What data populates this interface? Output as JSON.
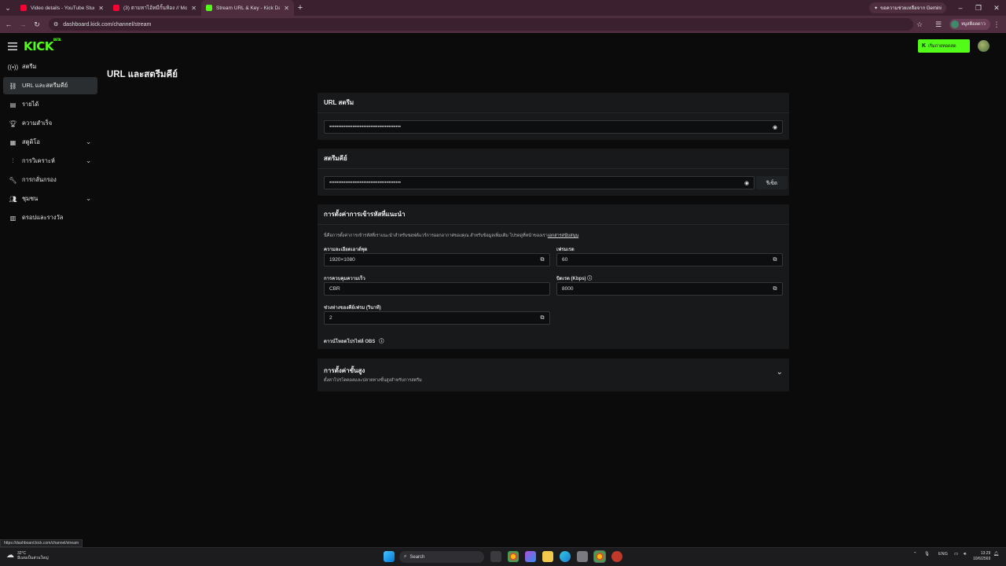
{
  "browser": {
    "tabs": [
      {
        "title": "Video details - YouTube Studio",
        "favicon_color": "#ff0033"
      },
      {
        "title": "(3) ตามหาไอ้หมีกั้นห้อง // Monster...",
        "favicon_color": "#ff0033"
      },
      {
        "title": "Stream URL & Key - Kick Dashb...",
        "favicon_color": "#53fc18"
      }
    ],
    "gemini_label": "ขอความช่วยเหลือจาก Gemini",
    "url": "dashboard.kick.com/channel/stream",
    "profile_name": "หมูสต็อดดาว"
  },
  "header": {
    "logo": "KICK",
    "logo_sup": "BETA",
    "go_live_label": "เริ่มถ่ายทอดสด"
  },
  "sidebar": {
    "items": [
      {
        "label": "สตรีม",
        "icon": "stream-icon"
      },
      {
        "label": "URL และสตรีมคีย์",
        "icon": "link-icon"
      },
      {
        "label": "รายได้",
        "icon": "revenue-icon"
      },
      {
        "label": "ความสำเร็จ",
        "icon": "trophy-icon"
      },
      {
        "label": "สตูดิโอ",
        "icon": "studio-icon"
      },
      {
        "label": "การวิเคราะห์",
        "icon": "analytics-icon"
      },
      {
        "label": "การกลั่นกรอง",
        "icon": "wrench-icon"
      },
      {
        "label": "ชุมชน",
        "icon": "community-icon"
      },
      {
        "label": "ดรอปและรางวัล",
        "icon": "drops-icon"
      }
    ]
  },
  "page": {
    "title": "URL และสตรีมคีย์",
    "stream_url": {
      "heading": "URL สตรีม",
      "value": "••••••••••••••••••••••••••••••••••••••••"
    },
    "stream_key": {
      "heading": "สตรีมคีย์",
      "value": "••••••••••••••••••••••••••••••••••••••••",
      "reset_label": "รีเซ็ต"
    },
    "encoder": {
      "heading": "การตั้งค่าการเข้ารหัสที่แนะนำ",
      "description": "นี่คือการตั้งค่าการเข้ารหัสที่เราแนะนำสำหรับซอฟต์แวร์การออกอากาศของคุณ สำหรับข้อมูลเพิ่มเติม โปรดดูที่หน้าของเรา",
      "description_link": "เอกสารสนับสนุน",
      "resolution_label": "ความละเอียดเอาต์พุต",
      "resolution_value": "1920×1080",
      "framerate_label": "เฟรมเรต",
      "framerate_value": "60",
      "rate_control_label": "การควบคุมความเร็ว",
      "rate_control_value": "CBR",
      "bitrate_label": "บิตเรต (Kbps)",
      "bitrate_value": "8000",
      "keyframe_label": "ช่วงห่างของคีย์เฟรม (วินาที)",
      "keyframe_value": "2",
      "obs_profile_label": "ดาวน์โหลดโปรไฟล์ OBS"
    },
    "advanced": {
      "heading": "การตั้งค่าขั้นสูง",
      "subtitle": "ตั้งค่าโปรโตคอลและปลายทางขั้นสูงสำหรับการสตรีม"
    }
  },
  "status_url": "https://dashboard.kick.com/channel/stream",
  "taskbar": {
    "weather_temp": "32°C",
    "weather_desc": "มีเมฆเป็นส่วนใหญ่",
    "search_label": "Search",
    "lang": "ENG",
    "time": "13:29",
    "date": "10/6/2569"
  }
}
